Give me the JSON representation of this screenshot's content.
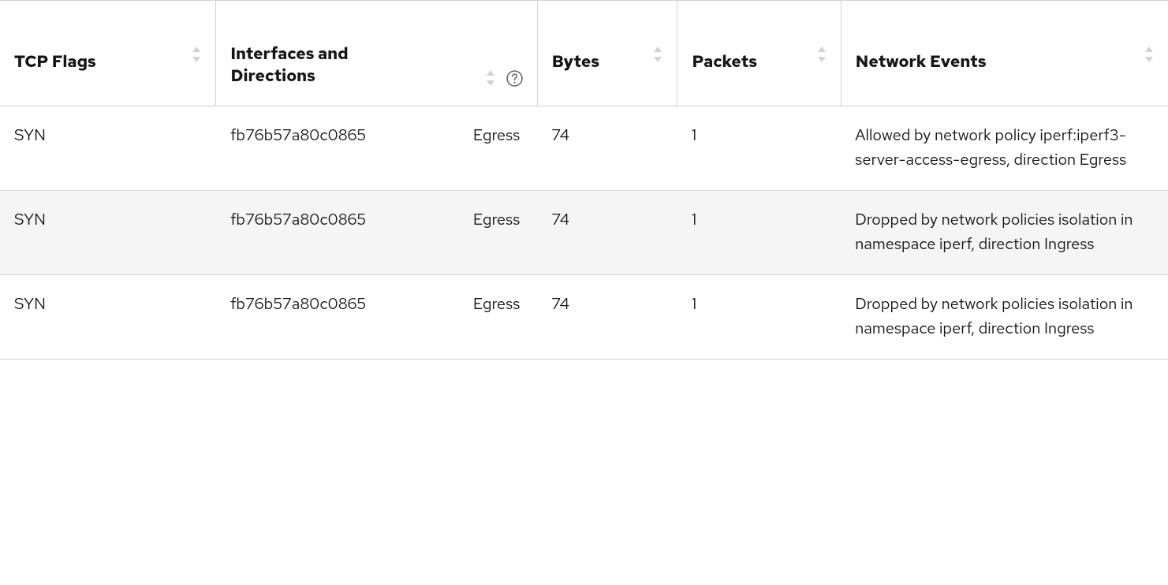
{
  "columns": {
    "tcp_flags": "TCP Flags",
    "interfaces": "Interfaces and Directions",
    "bytes": "Bytes",
    "packets": "Packets",
    "network_events": "Network Events"
  },
  "rows": [
    {
      "tcp_flags": "SYN",
      "interface": "fb76b57a80c0865",
      "direction": "Egress",
      "bytes": "74",
      "packets": "1",
      "event": "Allowed by network policy iperf:iperf3-server-access-egress, direction Egress"
    },
    {
      "tcp_flags": "SYN",
      "interface": "fb76b57a80c0865",
      "direction": "Egress",
      "bytes": "74",
      "packets": "1",
      "event": "Dropped by network policies isolation in namespace iperf, direction Ingress"
    },
    {
      "tcp_flags": "SYN",
      "interface": "fb76b57a80c0865",
      "direction": "Egress",
      "bytes": "74",
      "packets": "1",
      "event": "Dropped by network policies isolation in namespace iperf, direction Ingress"
    }
  ]
}
